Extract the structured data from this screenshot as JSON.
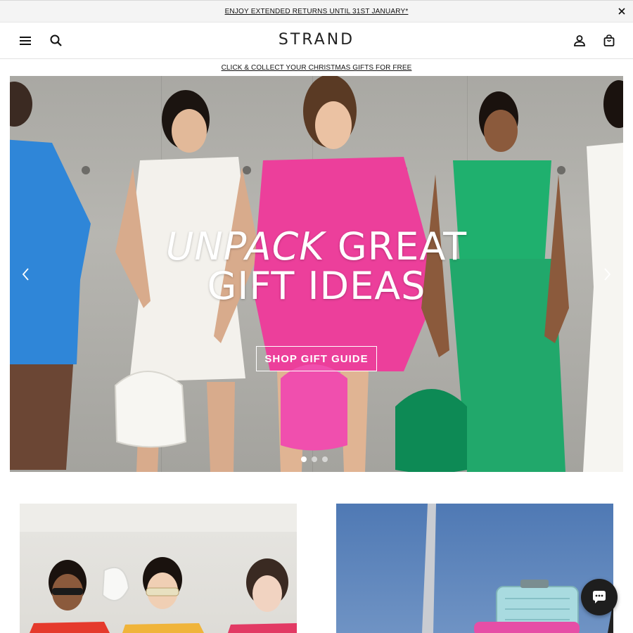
{
  "announcement": {
    "text": "ENJOY EXTENDED RETURNS UNTIL 31ST JANUARY*",
    "close_icon": "close-icon"
  },
  "header": {
    "logo": "STRAND",
    "icons": [
      "menu-icon",
      "search-icon",
      "account-icon",
      "bag-icon"
    ]
  },
  "promo": {
    "text": "CLICK & COLLECT YOUR CHRISTMAS GIFTS FOR FREE"
  },
  "hero": {
    "title_line1_italic": "UNPACK",
    "title_line1_rest": " GREAT",
    "title_line2": "GIFT IDEAS",
    "cta": "SHOP GIFT GUIDE",
    "slide_count": 3,
    "active_slide": 1
  },
  "chat": {
    "icon": "chat-bubble-icon"
  },
  "colors": {
    "outfit_blue": "#2f86d8",
    "outfit_white": "#f3f1ec",
    "outfit_pink": "#ec3f9b",
    "outfit_green": "#1fb06e",
    "bag_pink": "#f04fae",
    "bag_green": "#0d8a55",
    "wall": "#b1b0ab"
  }
}
